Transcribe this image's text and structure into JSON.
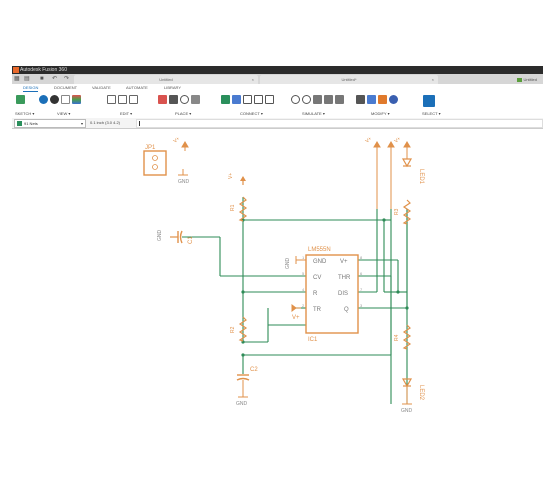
{
  "window": {
    "title": "Autodesk Fusion 360"
  },
  "doc_tabs": [
    {
      "label": "Untitled"
    },
    {
      "label": "Untitled*"
    }
  ],
  "workspace": {
    "label": "Untitled"
  },
  "ribbon_tabs": [
    "DESIGN",
    "DOCUMENT",
    "VALIDATE",
    "AUTOMATE",
    "LIBRARY"
  ],
  "groups": {
    "sketch": "SKETCH ▾",
    "view": "VIEW ▾",
    "edit": "EDIT ▾",
    "place": "PLACE ▾",
    "connect": "CONNECT ▾",
    "simulate": "SIMULATE ▾",
    "modify": "MODIFY ▾",
    "select": "SELECT ▾"
  },
  "cmdbar": {
    "layer": "91 Nets",
    "grid": "0.1 inch (3.0 4.2)"
  },
  "colors": {
    "wire": "#2e8b57",
    "part": "#e0914a",
    "accent": "#1b6fb8"
  },
  "schematic": {
    "ic_name": "LM555N",
    "ic_ref": "IC1",
    "pins_left": [
      "GND",
      "CV",
      "R",
      "TR"
    ],
    "pins_right": [
      "V+",
      "THR",
      "DIS",
      "Q"
    ],
    "pin_numbers": [
      "1",
      "5",
      "4",
      "2",
      "8",
      "6",
      "7",
      "3"
    ],
    "jp1": "JP1",
    "r1": "R1",
    "r2": "R2",
    "r3": "R3",
    "r4": "R4",
    "c1": "C1",
    "c2": "C2",
    "led1": "LED1",
    "led2": "LED2",
    "gnd": "GND",
    "vplus": "V+",
    "gnd_rot": "GND",
    "vplus_rot": "V+"
  }
}
